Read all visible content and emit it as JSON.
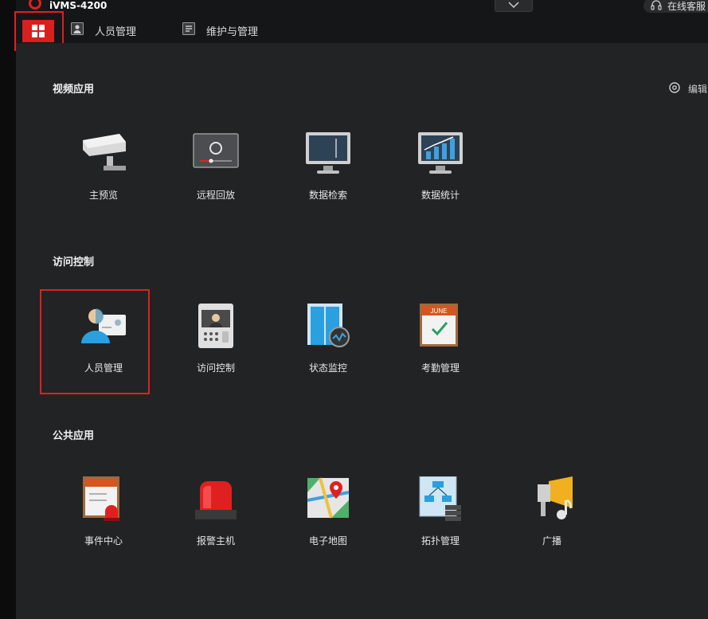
{
  "app": {
    "title": "iVMS-4200"
  },
  "header": {
    "service_label": "在线客服"
  },
  "nav": {
    "items": [
      {
        "label": "人员管理"
      },
      {
        "label": "维护与管理"
      }
    ]
  },
  "edit_label": "编辑",
  "sections": {
    "video": {
      "title": "视频应用",
      "items": [
        {
          "label": "主预览",
          "icon": "camera-icon"
        },
        {
          "label": "远程回放",
          "icon": "playback-icon"
        },
        {
          "label": "数据检索",
          "icon": "monitor-icon"
        },
        {
          "label": "数据统计",
          "icon": "bar-chart-icon"
        }
      ]
    },
    "access": {
      "title": "访问控制",
      "items": [
        {
          "label": "人员管理",
          "icon": "person-card-icon"
        },
        {
          "label": "访问控制",
          "icon": "door-station-icon"
        },
        {
          "label": "状态监控",
          "icon": "door-status-icon"
        },
        {
          "label": "考勤管理",
          "icon": "calendar-icon",
          "calendar_text": "JUNE"
        }
      ]
    },
    "public": {
      "title": "公共应用",
      "items": [
        {
          "label": "事件中心",
          "icon": "event-center-icon"
        },
        {
          "label": "报警主机",
          "icon": "alarm-siren-icon"
        },
        {
          "label": "电子地图",
          "icon": "map-pin-icon"
        },
        {
          "label": "拓扑管理",
          "icon": "topology-icon"
        },
        {
          "label": "广播",
          "icon": "broadcast-icon"
        }
      ]
    }
  },
  "colors": {
    "accent": "#e02020",
    "background": "#222325",
    "bar": "#151617"
  }
}
